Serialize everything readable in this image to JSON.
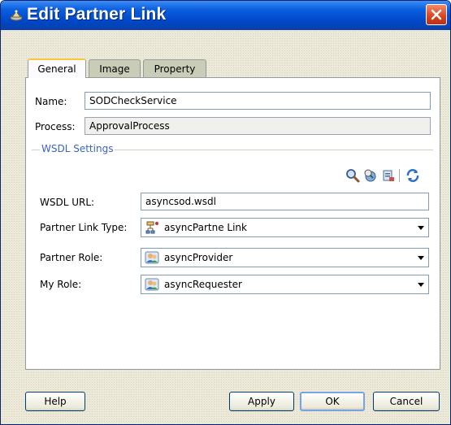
{
  "window": {
    "title": "Edit Partner Link"
  },
  "tabs": [
    {
      "label": "General",
      "active": true
    },
    {
      "label": "Image",
      "active": false
    },
    {
      "label": "Property",
      "active": false
    }
  ],
  "general": {
    "name_label": "Name:",
    "name_value": "SODCheckService",
    "process_label": "Process:",
    "process_value": "ApprovalProcess",
    "wsdl_group_title": "WSDL Settings",
    "toolbar_icons": [
      "search-icon",
      "browse-services-icon",
      "edit-wsdl-icon",
      "refresh-icon"
    ],
    "wsdl_url_label": "WSDL URL:",
    "wsdl_url_value": "asyncsod.wsdl",
    "partner_link_type_label": "Partner Link Type:",
    "partner_link_type_value": "asyncPartne Link",
    "partner_role_label": "Partner Role:",
    "partner_role_value": "asyncProvider",
    "my_role_label": "My Role:",
    "my_role_value": "asyncRequester"
  },
  "buttons": {
    "help": "Help",
    "apply": "Apply",
    "ok": "OK",
    "cancel": "Cancel"
  },
  "colors": {
    "titlebar": "#0a5fe0",
    "close": "#d9431c",
    "group_title": "#3b63c4",
    "tab_active_accent": "#ffc83c"
  }
}
